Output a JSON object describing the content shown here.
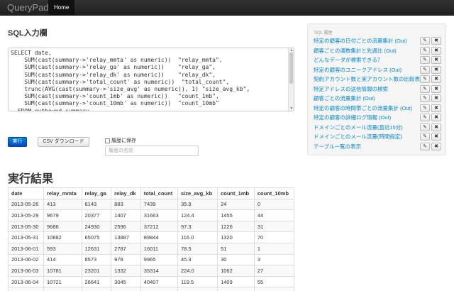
{
  "navbar": {
    "brand": "QueryPad",
    "home": "Home"
  },
  "sql": {
    "title": "SQL入力欄",
    "query": "SELECT date,\n    SUM(cast(summary->'relay_mmta' as numeric))  \"relay_mmta\",\n    SUM(cast(summary->'relay_ga' as numeric))    \"relay_ga\",\n    SUM(cast(summary->'relay_dk' as numeric))    \"relay_dk\",\n    SUM(cast(summary->'total_count' as numeric))  \"total_count\",\n    trunc(AVG(cast(summary->'size_avg' as numeric)), 1) \"size_avg_kb\",\n    SUM(cast(summary->'count_1mb' as numeric))   \"count_1mb\",\n    SUM(cast(summary->'count_10mb' as numeric))  \"count_10mb\"\n  FROM outbound_summary\n  WHERE domain IN"
  },
  "actions": {
    "run_label": "実行",
    "csv_label": "CSV ダウンロード",
    "save_history_label": "履歴に保存",
    "history_name_placeholder": "履歴の名前"
  },
  "results": {
    "title": "実行結果",
    "columns": [
      "date",
      "relay_mmta",
      "relay_ga",
      "relay_dk",
      "total_count",
      "size_avg_kb",
      "count_1mb",
      "count_10mb"
    ],
    "rows": [
      [
        "2013-05-26",
        "413",
        "6143",
        "883",
        "7439",
        "35.9",
        "24",
        "0"
      ],
      [
        "2013-05-29",
        "9679",
        "20377",
        "1407",
        "31663",
        "124.4",
        "1455",
        "44"
      ],
      [
        "2013-05-30",
        "9686",
        "24930",
        "2596",
        "37212",
        "97.3",
        "1226",
        "31"
      ],
      [
        "2013-05-31",
        "10882",
        "65075",
        "13887",
        "89844",
        "116.0",
        "1320",
        "70"
      ],
      [
        "2013-06-01",
        "593",
        "12631",
        "2787",
        "16011",
        "78.5",
        "51",
        "1"
      ],
      [
        "2013-06-02",
        "414",
        "8573",
        "978",
        "9965",
        "45.3",
        "30",
        "3"
      ],
      [
        "2013-06-03",
        "10781",
        "23201",
        "1332",
        "35314",
        "224.0",
        "1062",
        "27"
      ],
      [
        "2013-06-04",
        "10721",
        "26641",
        "3045",
        "40407",
        "119.5",
        "1409",
        "55"
      ],
      [
        "2013-06-05",
        "10050",
        "23641",
        "2160",
        "35851",
        "94.6",
        "1145",
        "12"
      ]
    ]
  },
  "sidebar": {
    "header": "SQL 履歴",
    "edit_icon": "✎",
    "delete_icon": "✖",
    "items": [
      "特定の顧客の日付ごとの流量集計 (Out)",
      "顧客ごとの通数集計と先週比 (Out)",
      "どんなデータが検索できる？",
      "特定の顧客のユニークアドレス (Out)",
      "契約アカウント数と実アカウント数の比較表",
      "特定アドレスの送信情報の検索",
      "顧客ごとの流量集計 (Out)",
      "特定の顧客の時間帯ごとの流量集計 (Out)",
      "特定の顧客の詳細ログ情報 (Out)",
      "ドメインごとのメール流量(直近15分)",
      "ドメインごとのメール流量(時間指定)",
      "テーブル一覧の表示"
    ]
  }
}
